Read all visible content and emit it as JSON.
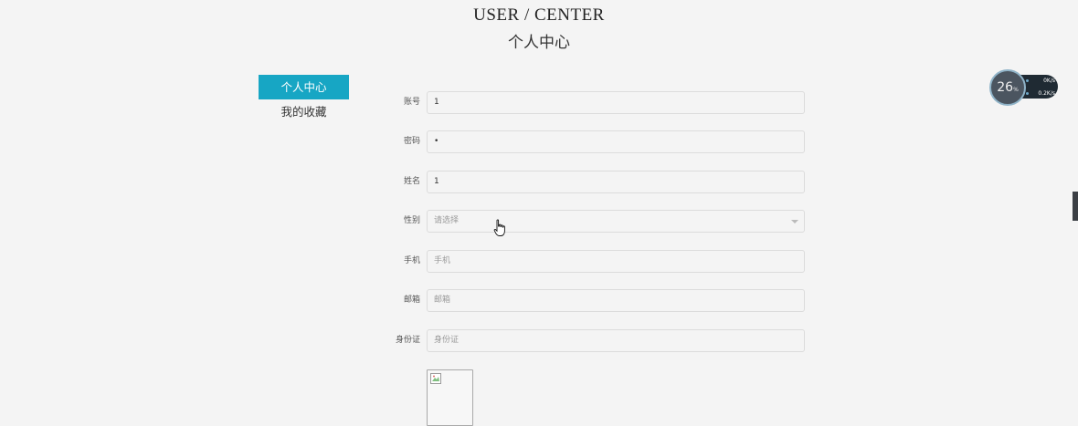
{
  "header": {
    "title": "USER / CENTER",
    "subtitle": "个人中心"
  },
  "side_nav": {
    "items": [
      {
        "label": "个人中心",
        "active": true
      },
      {
        "label": "我的收藏",
        "active": false
      }
    ],
    "active_color": "#17a6c4"
  },
  "form": {
    "account": {
      "label": "账号",
      "value": "1"
    },
    "password": {
      "label": "密码",
      "value": "•"
    },
    "name": {
      "label": "姓名",
      "value": "1"
    },
    "gender": {
      "label": "性别",
      "selected": "请选择"
    },
    "phone": {
      "label": "手机",
      "placeholder": "手机"
    },
    "email": {
      "label": "邮箱",
      "placeholder": "邮箱"
    },
    "id_card": {
      "label": "身份证",
      "placeholder": "身份证"
    }
  },
  "avatar": {
    "icon": "broken-image-icon"
  },
  "net_widget": {
    "temperature": "26",
    "temperature_unit": "%",
    "upload": "0",
    "upload_unit": "K/s",
    "download": "0.2",
    "download_unit": "K/s"
  }
}
